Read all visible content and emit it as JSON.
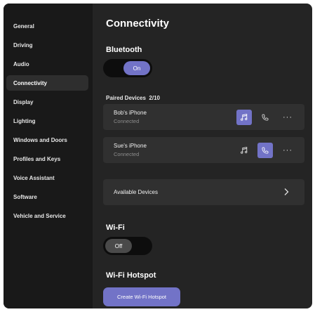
{
  "sidebar": {
    "items": [
      {
        "label": "General"
      },
      {
        "label": "Driving"
      },
      {
        "label": "Audio"
      },
      {
        "label": "Connectivity"
      },
      {
        "label": "Display"
      },
      {
        "label": "Lighting"
      },
      {
        "label": "Windows and Doors"
      },
      {
        "label": "Profiles and Keys"
      },
      {
        "label": "Voice Assistant"
      },
      {
        "label": "Software"
      },
      {
        "label": "Vehicle and Service"
      }
    ],
    "active_index": 3
  },
  "main": {
    "title": "Connectivity",
    "bluetooth": {
      "heading": "Bluetooth",
      "toggle_label": "On",
      "state": "on"
    },
    "paired": {
      "label": "Paired Devices",
      "count": "2/10",
      "devices": [
        {
          "name": "Bob's iPhone",
          "status": "Connected",
          "music_active": true,
          "phone_active": false
        },
        {
          "name": "Sue's iPhone",
          "status": "Connected",
          "music_active": false,
          "phone_active": true
        }
      ]
    },
    "available": {
      "label": "Available Devices"
    },
    "wifi": {
      "heading": "Wi-Fi",
      "toggle_label": "Off",
      "state": "off"
    },
    "hotspot": {
      "heading": "Wi-Fi Hotspot",
      "button_label": "Create Wi-Fi Hotspot"
    }
  },
  "icons": {
    "music": "music-note-icon",
    "phone": "phone-icon",
    "more": "more-horizontal-icon",
    "chevron": "chevron-right-icon"
  },
  "colors": {
    "accent": "#7273c7",
    "background": "#242424",
    "sidebar": "#191919",
    "card": "#303030"
  }
}
